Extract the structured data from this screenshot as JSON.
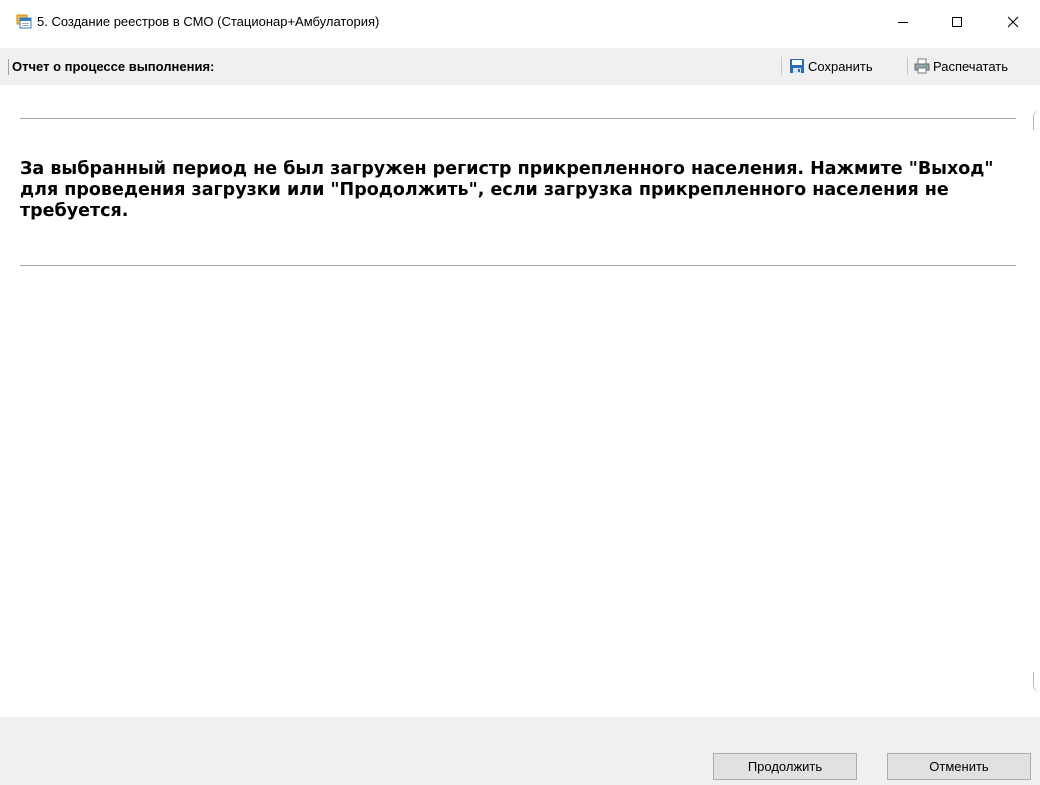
{
  "window": {
    "title": "5. Создание реестров в СМО  (Стационар+Амбулатория)",
    "icons": {
      "app": "window-stack-icon",
      "minimize": "minimize-icon",
      "maximize": "maximize-icon",
      "close": "close-icon"
    }
  },
  "toolbar": {
    "report_label": "Отчет о процессе выполнения:",
    "save_label": "Сохранить",
    "print_label": "Распечатать",
    "save_icon": "floppy-disk-icon",
    "print_icon": "printer-icon"
  },
  "content": {
    "message": "За выбранный период не был загружен регистр прикрепленного населения. Нажмите \"Выход\" для проведения загрузки или \"Продолжить\", если загрузка прикрепленного населения не требуется."
  },
  "footer": {
    "continue_label": "Продолжить",
    "cancel_label": "Отменить"
  },
  "colors": {
    "toolbar_bg": "#f0f0f0",
    "footer_bg": "#f0f0f0",
    "button_bg": "#e1e1e1",
    "button_border": "#adadad",
    "save_icon": "#2a6cb8"
  }
}
